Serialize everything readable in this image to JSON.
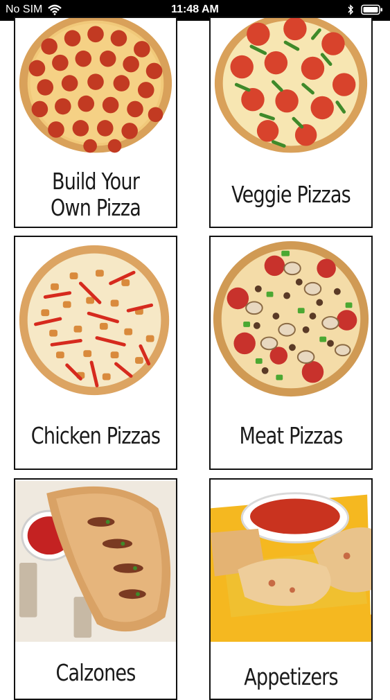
{
  "status_bar": {
    "carrier": "No SIM",
    "time": "11:48 AM",
    "icons": [
      "wifi-icon",
      "bluetooth-icon",
      "battery-icon"
    ]
  },
  "menu_icon": "hamburger-menu-icon",
  "categories": [
    {
      "label_line1": "Build Your",
      "label_line2": "Own Pizza",
      "image": "pepperoni-pizza"
    },
    {
      "label": "Veggie Pizzas",
      "image": "veggie-pizza"
    },
    {
      "label": "Chicken Pizzas",
      "image": "chicken-pizza"
    },
    {
      "label": "Meat Pizzas",
      "image": "meat-pizza"
    },
    {
      "label": "Calzones",
      "image": "calzone"
    },
    {
      "label": "Appetizers",
      "image": "appetizers"
    }
  ],
  "colors": {
    "border": "#111111",
    "text": "#1a1a1a",
    "menu_icon": "#3a84c8"
  }
}
